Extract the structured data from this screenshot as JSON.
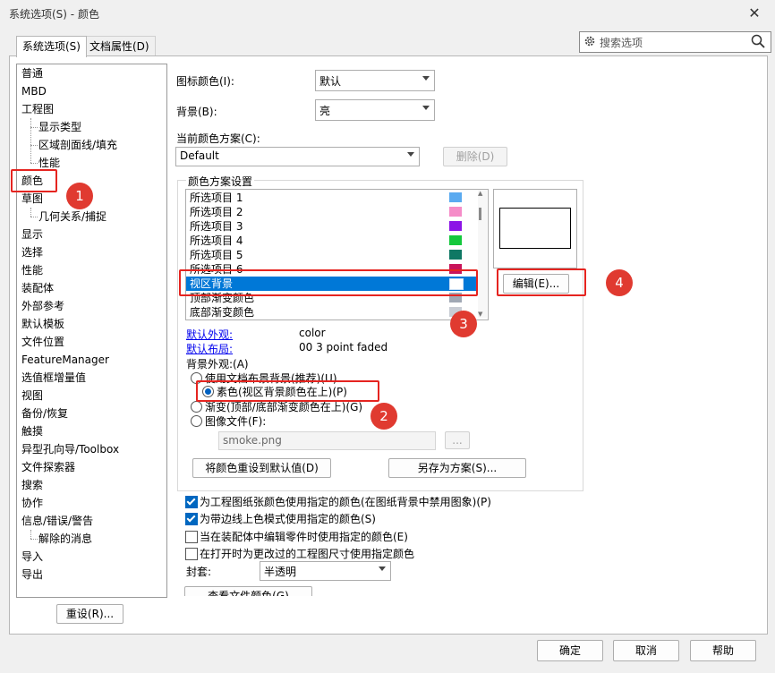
{
  "window": {
    "title": "系统选项(S) - 颜色",
    "close_glyph": "✕"
  },
  "tabs": [
    {
      "label": "系统选项(S)",
      "active": true
    },
    {
      "label": "文档属性(D)",
      "active": false
    }
  ],
  "search": {
    "placeholder": "搜索选项"
  },
  "tree": [
    {
      "label": "普通",
      "level": 0
    },
    {
      "label": "MBD",
      "level": 0
    },
    {
      "label": "工程图",
      "level": 0
    },
    {
      "label": "显示类型",
      "level": 1
    },
    {
      "label": "区域剖面线/填充",
      "level": 1
    },
    {
      "label": "性能",
      "level": 1
    },
    {
      "label": "颜色",
      "level": 0,
      "selected": true
    },
    {
      "label": "草图",
      "level": 0
    },
    {
      "label": "几何关系/捕捉",
      "level": 1
    },
    {
      "label": "显示",
      "level": 0
    },
    {
      "label": "选择",
      "level": 0
    },
    {
      "label": "性能",
      "level": 0
    },
    {
      "label": "装配体",
      "level": 0
    },
    {
      "label": "外部参考",
      "level": 0
    },
    {
      "label": "默认模板",
      "level": 0
    },
    {
      "label": "文件位置",
      "level": 0
    },
    {
      "label": "FeatureManager",
      "level": 0
    },
    {
      "label": "选值框增量值",
      "level": 0
    },
    {
      "label": "视图",
      "level": 0
    },
    {
      "label": "备份/恢复",
      "level": 0
    },
    {
      "label": "触摸",
      "level": 0
    },
    {
      "label": "异型孔向导/Toolbox",
      "level": 0
    },
    {
      "label": "文件探索器",
      "level": 0
    },
    {
      "label": "搜索",
      "level": 0
    },
    {
      "label": "协作",
      "level": 0
    },
    {
      "label": "信息/错误/警告",
      "level": 0
    },
    {
      "label": "解除的消息",
      "level": 1
    },
    {
      "label": "导入",
      "level": 0
    },
    {
      "label": "导出",
      "level": 0
    }
  ],
  "reset_button": "重设(R)...",
  "icon_color": {
    "label": "图标颜色(I):",
    "value": "默认"
  },
  "background": {
    "label": "背景(B):",
    "value": "亮"
  },
  "scheme": {
    "label": "当前颜色方案(C):",
    "value": "Default",
    "delete_button": "删除(D)"
  },
  "scheme_settings": {
    "label": "颜色方案设置",
    "items": [
      {
        "label": "所选项目 1",
        "color": "#5aaaf0"
      },
      {
        "label": "所选项目 2",
        "color": "#f58cc8"
      },
      {
        "label": "所选项目 3",
        "color": "#8c14e6"
      },
      {
        "label": "所选项目 4",
        "color": "#14c83c"
      },
      {
        "label": "所选项目 5",
        "color": "#0f7864"
      },
      {
        "label": "所选项目 6",
        "color": "#c8145a"
      },
      {
        "label": "视区背景",
        "color": "#ffffff",
        "selected": true
      },
      {
        "label": "顶部渐变颜色",
        "color": "#a0a8b4"
      },
      {
        "label": "底部渐变颜色",
        "color": "#c8ccd4"
      }
    ],
    "edit_button": "编辑(E)...",
    "default_appearance": {
      "label": "默认外观:",
      "value": "color"
    },
    "default_layout": {
      "label": "默认布局:",
      "value": "00 3 point faded"
    },
    "bg_appearance_label": "背景外观:(A)",
    "radio_options": [
      {
        "label": "使用文档布景背景(推荐)(U)",
        "checked": false
      },
      {
        "label": "素色(视区背景颜色在上)(P)",
        "checked": true
      },
      {
        "label": "渐变(顶部/底部渐变颜色在上)(G)",
        "checked": false
      },
      {
        "label": "图像文件(F):",
        "checked": false
      }
    ],
    "image_file": "smoke.png",
    "browse_button": "...",
    "reset_colors_button": "将颜色重设到默认值(D)",
    "save_scheme_button": "另存为方案(S)..."
  },
  "checkboxes": [
    {
      "label": "为工程图纸张颜色使用指定的颜色(在图纸背景中禁用图象)(P)",
      "checked": true
    },
    {
      "label": "为带边线上色模式使用指定的颜色(S)",
      "checked": true
    },
    {
      "label": "当在装配体中编辑零件时使用指定的颜色(E)",
      "checked": false
    },
    {
      "label": "在打开时为更改过的工程图尺寸使用指定颜色",
      "checked": false
    }
  ],
  "envelope": {
    "label": "封套:",
    "value": "半透明"
  },
  "view_file_colors_button": "查看文件颜色(G)",
  "footer": {
    "ok": "确定",
    "cancel": "取消",
    "help": "帮助"
  },
  "annotations": [
    "1",
    "2",
    "3",
    "4"
  ],
  "accent_color": "#0078d7",
  "annotation_color": "#e52420"
}
